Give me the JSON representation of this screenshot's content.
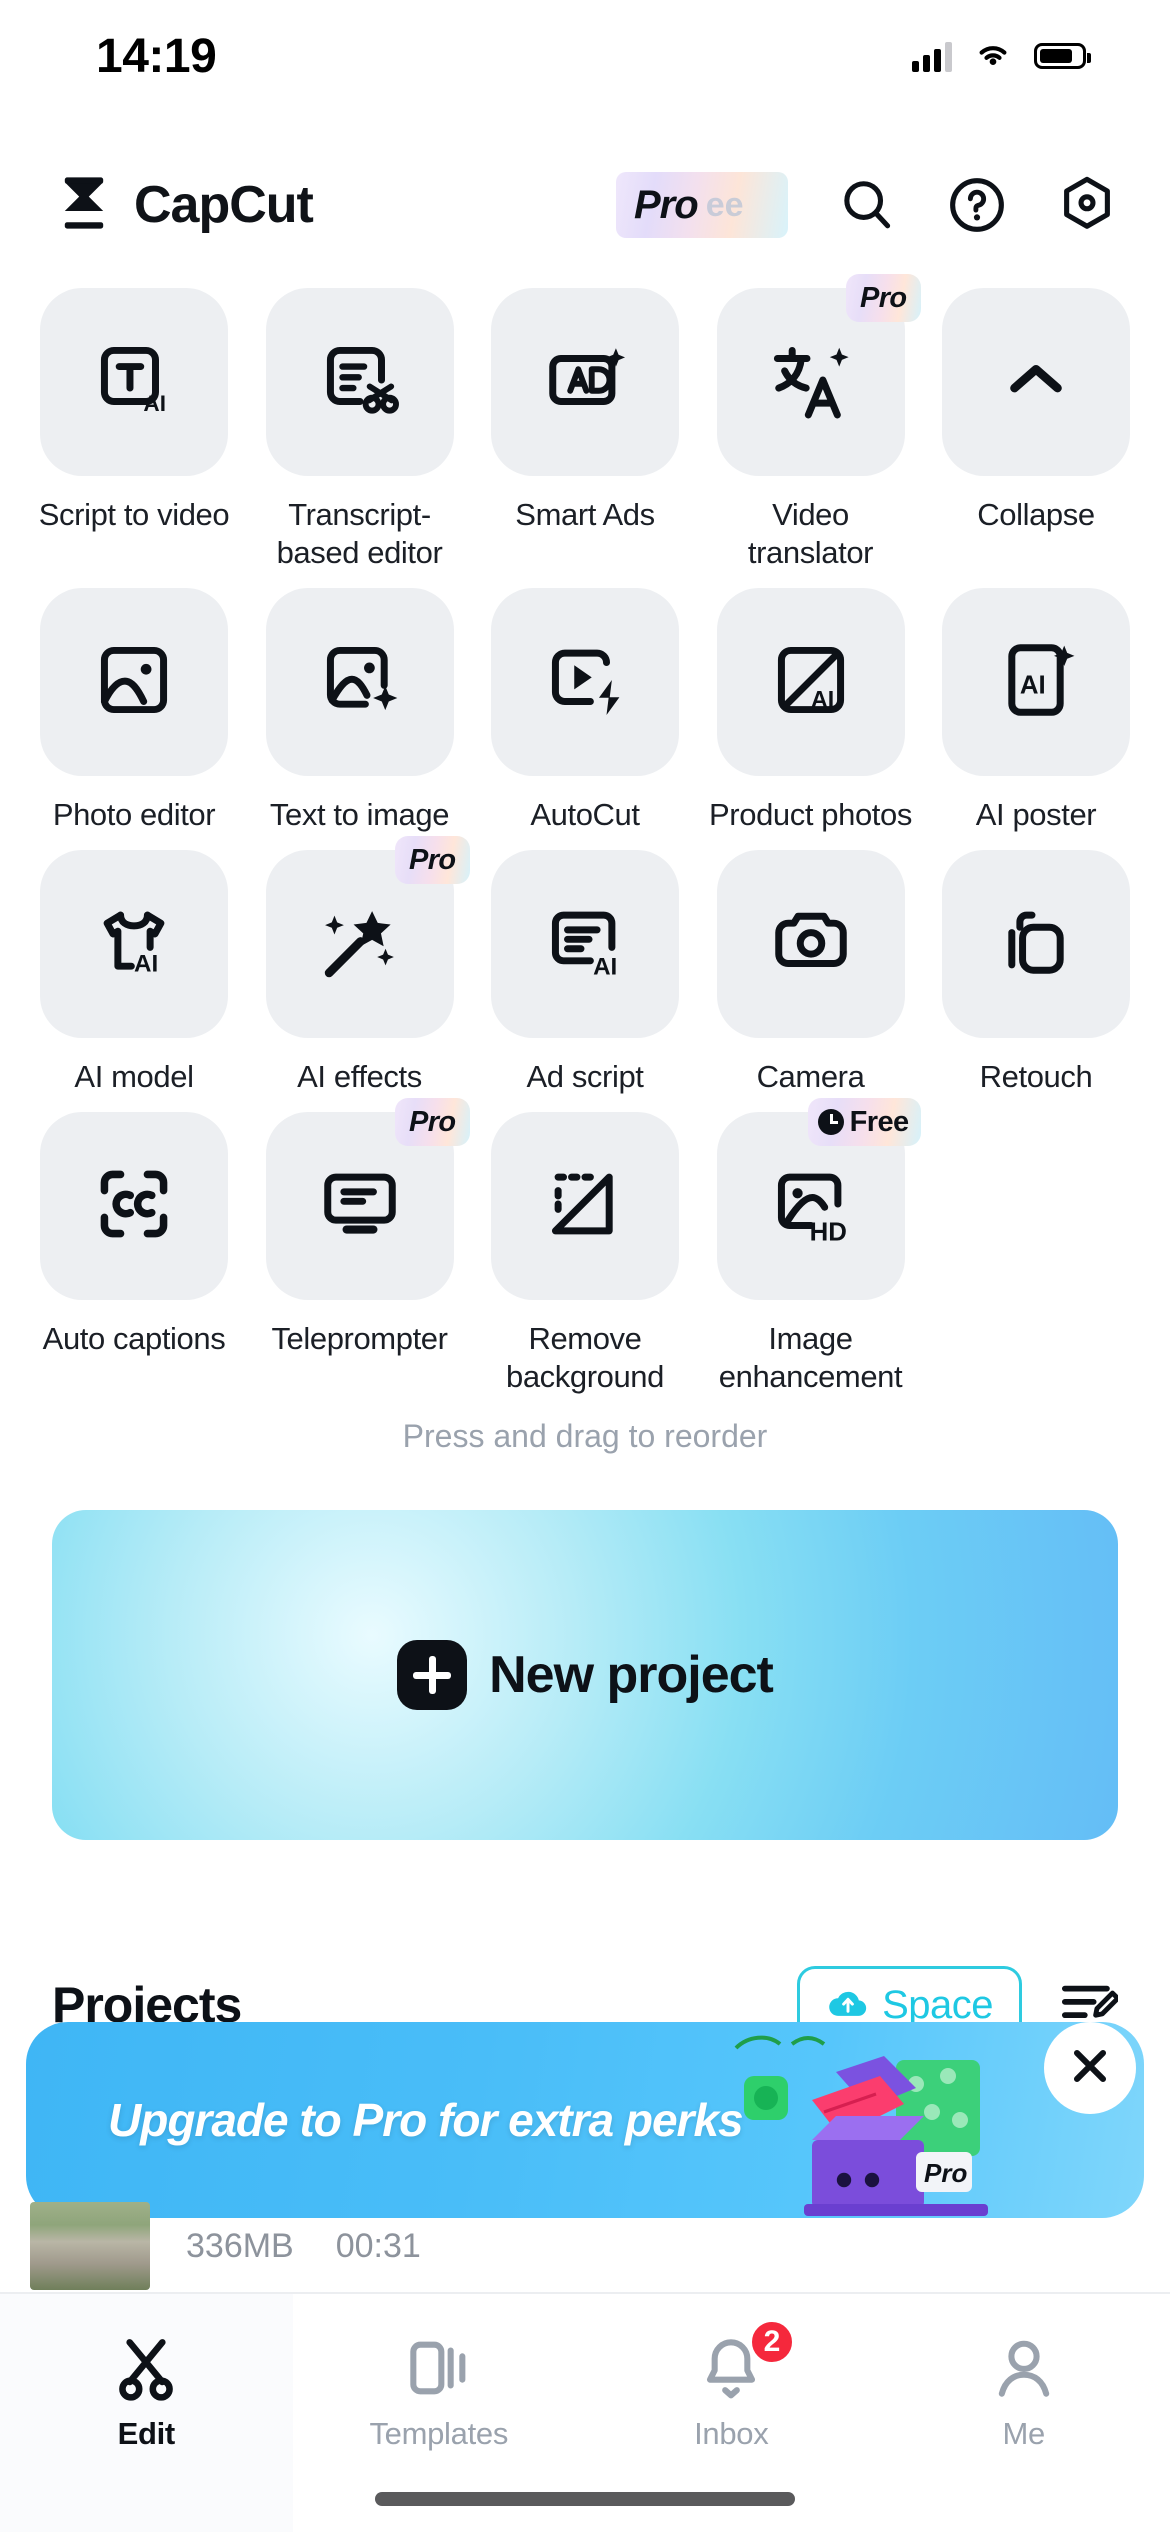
{
  "status_bar": {
    "time": "14:19",
    "cellular_icon": "cellular-signal-icon",
    "wifi_icon": "wifi-icon",
    "battery_icon": "battery-icon"
  },
  "header": {
    "logo_icon": "capcut-logo-icon",
    "brand": "CapCut",
    "pro_pill": {
      "label": "Pro",
      "ghost_label": "ee"
    },
    "search_icon": "search-icon",
    "help_icon": "help-circle-icon",
    "settings_icon": "settings-gear-icon"
  },
  "tools": {
    "reorder_hint": "Press and drag to reorder",
    "rows": [
      [
        {
          "label": "Script to video",
          "icon": "script-to-video-icon",
          "badge": null
        },
        {
          "label": "Transcript-based editor",
          "icon": "transcript-editor-icon",
          "badge": null
        },
        {
          "label": "Smart Ads",
          "icon": "smart-ads-icon",
          "badge": null
        },
        {
          "label": "Video translator",
          "icon": "video-translator-icon",
          "badge": "Pro"
        },
        {
          "label": "Collapse",
          "icon": "chevron-up-icon",
          "badge": null
        }
      ],
      [
        {
          "label": "Photo editor",
          "icon": "photo-editor-icon",
          "badge": null
        },
        {
          "label": "Text to image",
          "icon": "text-to-image-icon",
          "badge": null
        },
        {
          "label": "AutoCut",
          "icon": "autocut-icon",
          "badge": null
        },
        {
          "label": "Product photos",
          "icon": "product-photos-icon",
          "badge": null
        },
        {
          "label": "AI poster",
          "icon": "ai-poster-icon",
          "badge": null
        }
      ],
      [
        {
          "label": "AI model",
          "icon": "ai-model-icon",
          "badge": null
        },
        {
          "label": "AI effects",
          "icon": "ai-effects-wand-icon",
          "badge": "Pro"
        },
        {
          "label": "Ad script",
          "icon": "ad-script-icon",
          "badge": null
        },
        {
          "label": "Camera",
          "icon": "camera-icon",
          "badge": null
        },
        {
          "label": "Retouch",
          "icon": "retouch-icon",
          "badge": null
        }
      ],
      [
        {
          "label": "Auto captions",
          "icon": "closed-caption-icon",
          "badge": null
        },
        {
          "label": "Teleprompter",
          "icon": "teleprompter-icon",
          "badge": "Pro"
        },
        {
          "label": "Remove background",
          "icon": "remove-background-icon",
          "badge": null
        },
        {
          "label": "Image enhancement",
          "icon": "image-enhancement-hd-icon",
          "badge": "Free"
        },
        {
          "label": "",
          "icon": null,
          "badge": null
        }
      ]
    ]
  },
  "new_project": {
    "label": "New project",
    "plus_icon": "plus-icon"
  },
  "projects": {
    "title": "Projects",
    "space_label": "Space",
    "space_icon": "cloud-space-icon",
    "manage_icon": "edit-list-icon",
    "banner": {
      "text": "Upgrade to Pro for extra perks",
      "pro_tag": "Pro",
      "close_icon": "close-icon"
    },
    "item": {
      "size": "336MB",
      "duration": "00:31"
    }
  },
  "tabbar": {
    "tabs": [
      {
        "label": "Edit",
        "icon": "scissors-icon",
        "active": true,
        "badge": null
      },
      {
        "label": "Templates",
        "icon": "templates-icon",
        "active": false,
        "badge": null
      },
      {
        "label": "Inbox",
        "icon": "bell-icon",
        "active": false,
        "badge": "2"
      },
      {
        "label": "Me",
        "icon": "person-icon",
        "active": false,
        "badge": null
      }
    ]
  },
  "colors": {
    "accent_cyan": "#1ec8e3",
    "badge_red": "#f5283c",
    "tile_bg": "#edeff2",
    "text_primary": "#0d1117",
    "text_muted": "#9aa2ad"
  }
}
